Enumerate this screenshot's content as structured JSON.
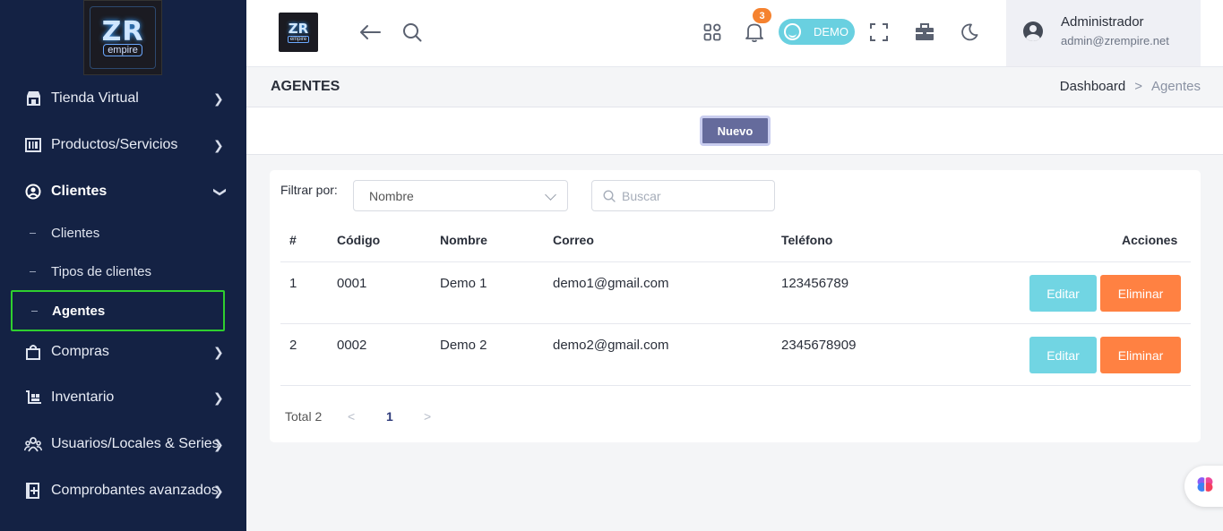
{
  "brand": {
    "logo_text": "ZR",
    "logo_sub": "empire"
  },
  "sidebar": {
    "items": [
      {
        "label": "Tienda Virtual",
        "icon": "store-icon"
      },
      {
        "label": "Productos/Servicios",
        "icon": "barcode-icon"
      },
      {
        "label": "Clientes",
        "icon": "user-circle-icon"
      },
      {
        "label": "Compras",
        "icon": "bag-icon"
      },
      {
        "label": "Inventario",
        "icon": "warehouse-icon"
      },
      {
        "label": "Usuarios/Locales & Series",
        "icon": "users-icon"
      },
      {
        "label": "Comprobantes avanzados",
        "icon": "document-plus-icon"
      }
    ],
    "sub_items": [
      {
        "label": "Clientes"
      },
      {
        "label": "Tipos de clientes"
      },
      {
        "label": "Agentes"
      }
    ]
  },
  "topbar": {
    "notification_count": "3",
    "demo_label": "DEMO",
    "user_name": "Administrador",
    "user_email": "admin@zrempire.net"
  },
  "header": {
    "title": "AGENTES",
    "breadcrumb_home": "Dashboard",
    "breadcrumb_sep": ">",
    "breadcrumb_current": "Agentes"
  },
  "actions": {
    "new_label": "Nuevo"
  },
  "filter": {
    "label": "Filtrar por:",
    "selected": "Nombre",
    "search_placeholder": "Buscar"
  },
  "table": {
    "headers": [
      "#",
      "Código",
      "Nombre",
      "Correo",
      "Teléfono",
      "Acciones"
    ],
    "rows": [
      {
        "num": "1",
        "code": "0001",
        "name": "Demo 1",
        "email": "demo1@gmail.com",
        "phone": "123456789"
      },
      {
        "num": "2",
        "code": "0002",
        "name": "Demo 2",
        "email": "demo2@gmail.com",
        "phone": "2345678909"
      }
    ],
    "edit_label": "Editar",
    "delete_label": "Eliminar"
  },
  "pagination": {
    "total": "Total 2",
    "current_page": "1",
    "prev": "<",
    "next": ">"
  },
  "colors": {
    "sidebar_bg": "#142244",
    "edit": "#71d5e3",
    "delete": "#ff8142",
    "primary": "#656b9c",
    "highlight": "#2fcf2f"
  }
}
